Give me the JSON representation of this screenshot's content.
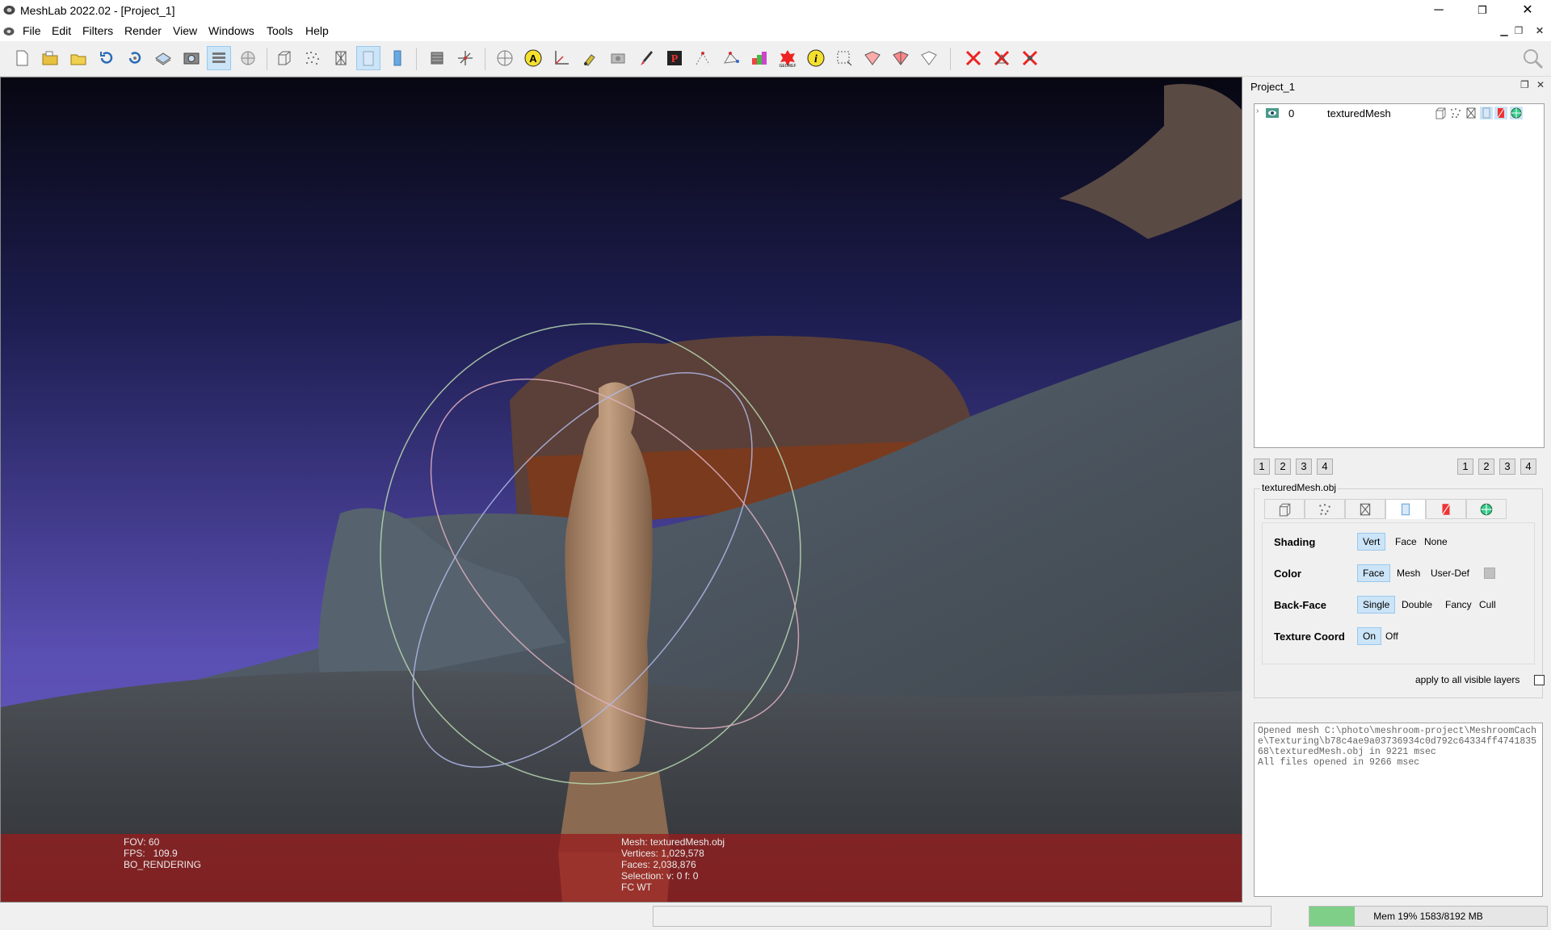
{
  "window": {
    "title": "MeshLab 2022.02 - [Project_1]",
    "minimize_glyph": "─",
    "maximize_glyph": "❐",
    "close_glyph": "✕"
  },
  "menu": {
    "items": [
      "File",
      "Edit",
      "Filters",
      "Render",
      "View",
      "Windows",
      "Tools",
      "Help"
    ]
  },
  "toolbar": {
    "icons": [
      "new-project-icon",
      "open-project-icon",
      "import-mesh-icon",
      "reload-icon",
      "reload-all-icon",
      "export-mesh-icon",
      "snapshot-icon",
      "layers-icon",
      "raster-layers-icon",
      "bbox-icon",
      "points-icon",
      "wireframe-icon",
      "flat-shading-icon",
      "smooth-shading-icon",
      "light-icon",
      "trackball-axes-icon",
      "measure-icon",
      "annotate-icon",
      "align-icon",
      "paint-icon",
      "brush-icon",
      "pickpoints-icon",
      "select-vertex-icon",
      "select-face-icon",
      "quality-mapper-icon",
      "georef-icon",
      "info-icon",
      "select-rect-icon",
      "select-conn-icon",
      "select-draw-icon",
      "select-z-icon",
      "delete-vertex-icon",
      "delete-face-icon",
      "delete-selection-icon"
    ]
  },
  "viewport": {
    "overlay_left": [
      "FOV: 60",
      "FPS:   109.9",
      "BO_RENDERING"
    ],
    "overlay_center": [
      "Mesh: texturedMesh.obj",
      "Vertices: 1,029,578",
      "Faces: 2,038,876",
      "Selection: v: 0 f: 0",
      "FC WT"
    ]
  },
  "panel": {
    "title": "Project_1",
    "layer": {
      "index": "0",
      "name": "texturedMesh"
    },
    "left_numbers": [
      "1",
      "2",
      "3",
      "4"
    ],
    "right_numbers": [
      "1",
      "2",
      "3",
      "4"
    ],
    "properties": {
      "filename": "texturedMesh.obj",
      "shading_label": "Shading",
      "shading_options": [
        "Vert",
        "Face",
        "None"
      ],
      "color_label": "Color",
      "color_options": [
        "Face",
        "Mesh",
        "User-Def"
      ],
      "backface_label": "Back-Face",
      "backface_options": [
        "Single",
        "Double",
        "Fancy",
        "Cull"
      ],
      "texcoord_label": "Texture Coord",
      "texcoord_options": [
        "On",
        "Off"
      ],
      "apply_all": "apply to all visible layers"
    },
    "log": [
      "Opened mesh C:\\photo\\meshroom-project\\MeshroomCache\\Texturing\\b78c4ae9a03736934c0d792c64334ff474183568\\texturedMesh.obj in 9221 msec",
      "All files opened in 9266 msec"
    ]
  },
  "status": {
    "memory_text": "Mem 19% 1583/8192 MB",
    "memory_percent": 19
  },
  "colors": {
    "accent": "#cce4f7",
    "memory_fill": "#7fcf88",
    "overlay": "#961e1e"
  }
}
